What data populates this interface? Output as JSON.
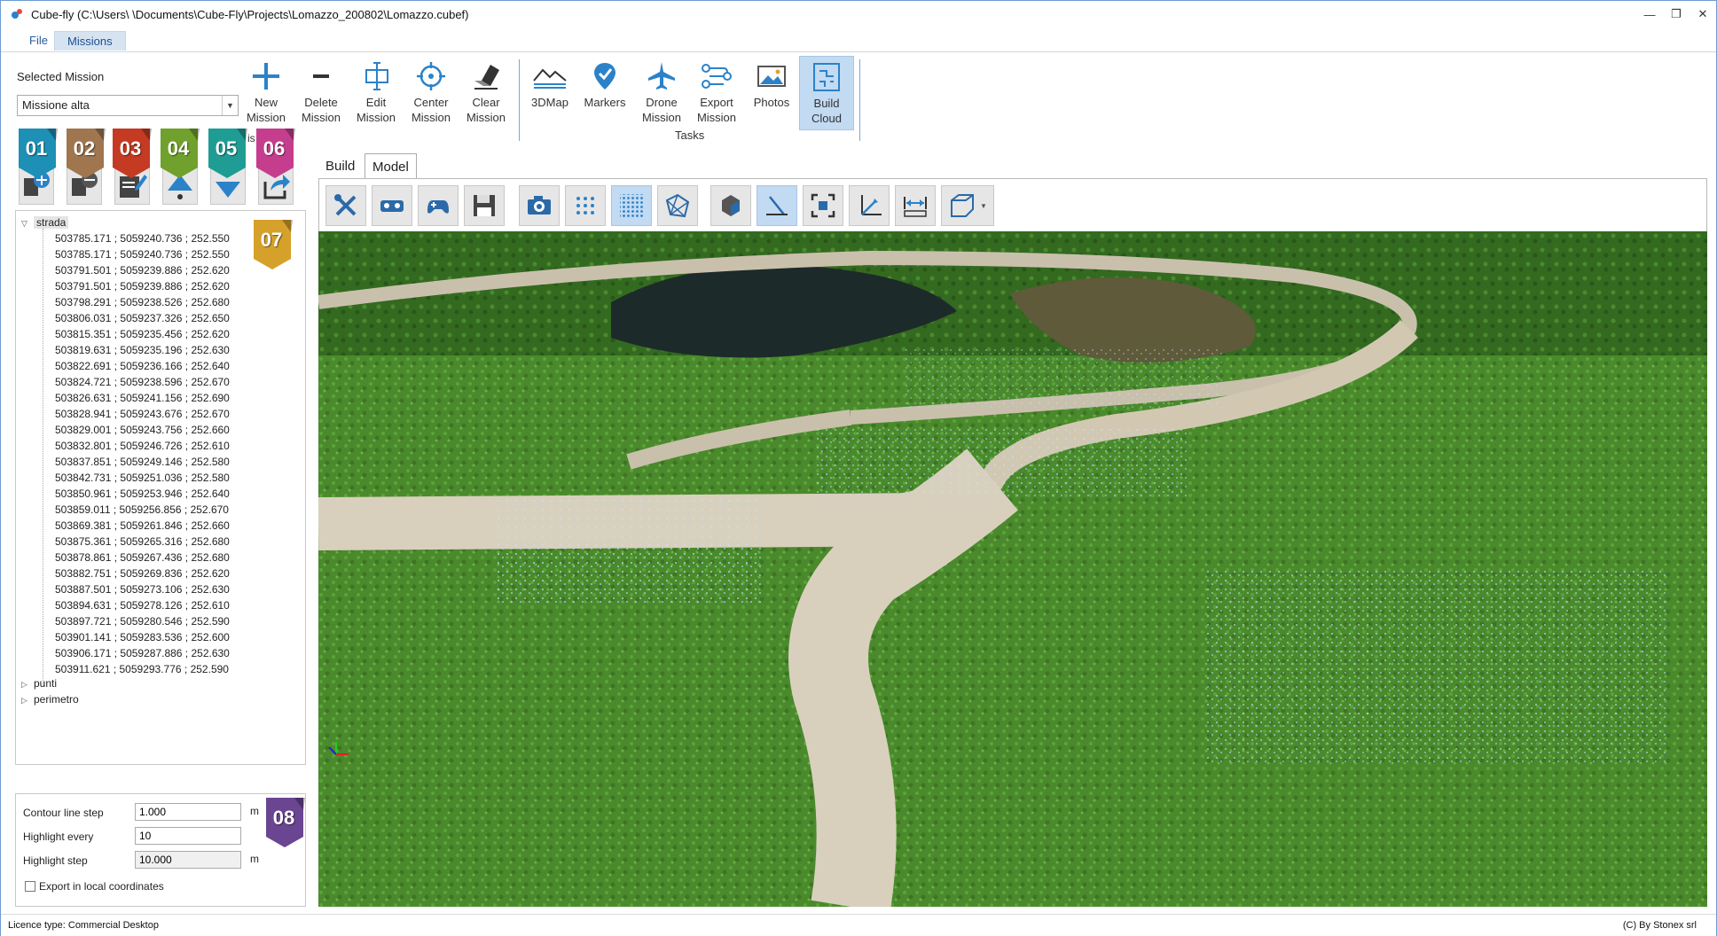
{
  "window": {
    "title": "Cube-fly (C:\\Users\\          \\Documents\\Cube-Fly\\Projects\\Lomazzo_200802\\Lomazzo.cubef)",
    "controls": [
      "—",
      "❐",
      "✕"
    ]
  },
  "menu": {
    "items": [
      "File",
      "Missions"
    ],
    "active": "Missions"
  },
  "mission": {
    "label": "Selected Mission",
    "value": "Missione alta"
  },
  "ribbon": {
    "mission_buttons": [
      {
        "line1": "New",
        "line2": "Mission",
        "icon": "plus-icon"
      },
      {
        "line1": "Delete",
        "line2": "Mission",
        "icon": "minus-icon"
      },
      {
        "line1": "Edit",
        "line2": "Mission",
        "icon": "edit-icon"
      },
      {
        "line1": "Center",
        "line2": "Mission",
        "icon": "crosshair-icon"
      },
      {
        "line1": "Clear",
        "line2": "Mission",
        "icon": "eraser-icon"
      }
    ],
    "task_buttons": [
      {
        "line1": "3DMap",
        "line2": "",
        "icon": "terrain-icon"
      },
      {
        "line1": "Markers",
        "line2": "",
        "icon": "marker-icon"
      },
      {
        "line1": "Drone",
        "line2": "Mission",
        "icon": "plane-icon"
      },
      {
        "line1": "Export",
        "line2": "Mission",
        "icon": "export-route-icon"
      },
      {
        "line1": "Photos",
        "line2": "",
        "icon": "photos-icon"
      },
      {
        "line1": "Build",
        "line2": "Cloud",
        "icon": "cloud-build-icon"
      }
    ],
    "tasks_label": "Tasks",
    "fragment": "is"
  },
  "badges": [
    "01",
    "02",
    "03",
    "04",
    "05",
    "06",
    "07",
    "08"
  ],
  "badge_colors": [
    "#1e8fb5",
    "#a0764f",
    "#c43a22",
    "#6fa12c",
    "#1f9d94",
    "#c53e8e",
    "#d6a12a",
    "#6a4592"
  ],
  "tree": {
    "root": "strada",
    "coords": [
      "503785.171 ; 5059240.736 ; 252.550",
      "503785.171 ; 5059240.736 ; 252.550",
      "503791.501 ; 5059239.886 ; 252.620",
      "503791.501 ; 5059239.886 ; 252.620",
      "503798.291 ; 5059238.526 ; 252.680",
      "503806.031 ; 5059237.326 ; 252.650",
      "503815.351 ; 5059235.456 ; 252.620",
      "503819.631 ; 5059235.196 ; 252.630",
      "503822.691 ; 5059236.166 ; 252.640",
      "503824.721 ; 5059238.596 ; 252.670",
      "503826.631 ; 5059241.156 ; 252.690",
      "503828.941 ; 5059243.676 ; 252.670",
      "503829.001 ; 5059243.756 ; 252.660",
      "503832.801 ; 5059246.726 ; 252.610",
      "503837.851 ; 5059249.146 ; 252.580",
      "503842.731 ; 5059251.036 ; 252.580",
      "503850.961 ; 5059253.946 ; 252.640",
      "503859.011 ; 5059256.856 ; 252.670",
      "503869.381 ; 5059261.846 ; 252.660",
      "503875.361 ; 5059265.316 ; 252.680",
      "503878.861 ; 5059267.436 ; 252.680",
      "503882.751 ; 5059269.836 ; 252.620",
      "503887.501 ; 5059273.106 ; 252.630",
      "503894.631 ; 5059278.126 ; 252.610",
      "503897.721 ; 5059280.546 ; 252.590",
      "503901.141 ; 5059283.536 ; 252.600",
      "503906.171 ; 5059287.886 ; 252.630",
      "503911.621 ; 5059293.776 ; 252.590"
    ],
    "others": [
      "punti",
      "perimetro"
    ]
  },
  "settings": {
    "contour_label": "Contour line step",
    "contour_value": "1.000",
    "unit": "m",
    "highlight_every_label": "Highlight every",
    "highlight_every_value": "10",
    "highlight_step_label": "Highlight step",
    "highlight_step_value": "10.000",
    "export_local_label": "Export in local coordinates"
  },
  "tabs": [
    "Build",
    "Model"
  ],
  "active_tab": "Model",
  "model_toolbar": [
    "tools-icon",
    "vr-glasses-icon",
    "gamepad-icon",
    "save-icon",
    "camera-icon",
    "sparse-points-icon",
    "dense-points-icon",
    "mesh-icon",
    "solid-icon",
    "line-measure-icon",
    "fit-view-icon",
    "axes-icon",
    "distance-icon",
    "cube-view-icon"
  ],
  "status": {
    "license": "Licence type: Commercial Desktop",
    "copyright": "(C) By Stonex srl"
  }
}
